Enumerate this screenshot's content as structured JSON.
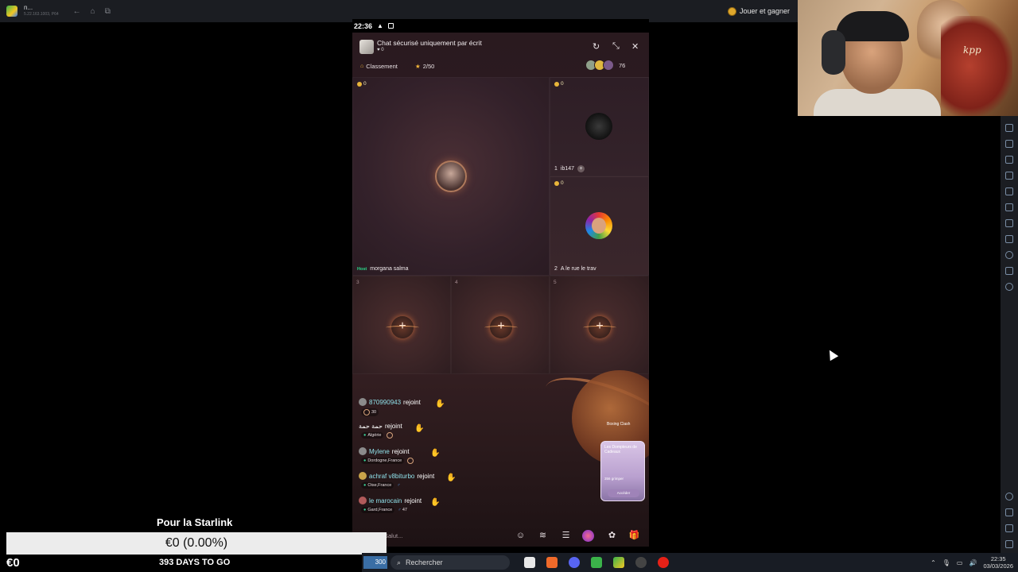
{
  "emulator": {
    "title": "n...",
    "subtitle": "5.22.163.1003, P64",
    "reward_label": "Jouer et gagner"
  },
  "webcam": {
    "painting_text": "kpp"
  },
  "phone": {
    "status": {
      "time": "22:36"
    },
    "room": {
      "title": "Chat sécurisé uniquement par écrit",
      "heart_count": "0",
      "ranking_label": "Classement",
      "seats_count": "2/50",
      "viewer_count": "76"
    },
    "seats": {
      "host": {
        "beans": "0",
        "tag": "Host",
        "name": "morgana salma"
      },
      "seat1": {
        "beans": "0",
        "number": "1",
        "name": "ib147"
      },
      "seat2": {
        "beans": "0",
        "number": "2",
        "name": "A le rue le trav"
      },
      "empty": [
        {
          "number": "3"
        },
        {
          "number": "4"
        },
        {
          "number": "5"
        }
      ]
    },
    "feed": [
      {
        "name": "870990943",
        "action": "rejoint",
        "sub": "30"
      },
      {
        "name": "حمة حمة",
        "action": "rejoint",
        "sub": "Algérie"
      },
      {
        "name": "Mylene",
        "action": "rejoint",
        "sub": "Dordogne,France"
      },
      {
        "name": "achraf v8biturbo",
        "action": "rejoint",
        "sub": "Oise,France"
      },
      {
        "name": "le marocain",
        "action": "rejoint",
        "sub": "Gard,France",
        "extra": "47"
      }
    ],
    "events_label": "Boxing Clash",
    "promo": {
      "title": "Les Dompteurs de Cadeaux",
      "subtitle": "356 grimper",
      "button": "Accéder"
    },
    "input_placeholder": "Salut..."
  },
  "overlay": {
    "title": "Pour la Starlink",
    "progress_text": "€0 (0.00%)",
    "amount": "€0",
    "countdown": "393 DAYS TO GO"
  },
  "taskbar": {
    "weather": "300",
    "search": "Rechercher",
    "time": "22:35",
    "date": "03/03/2026"
  }
}
